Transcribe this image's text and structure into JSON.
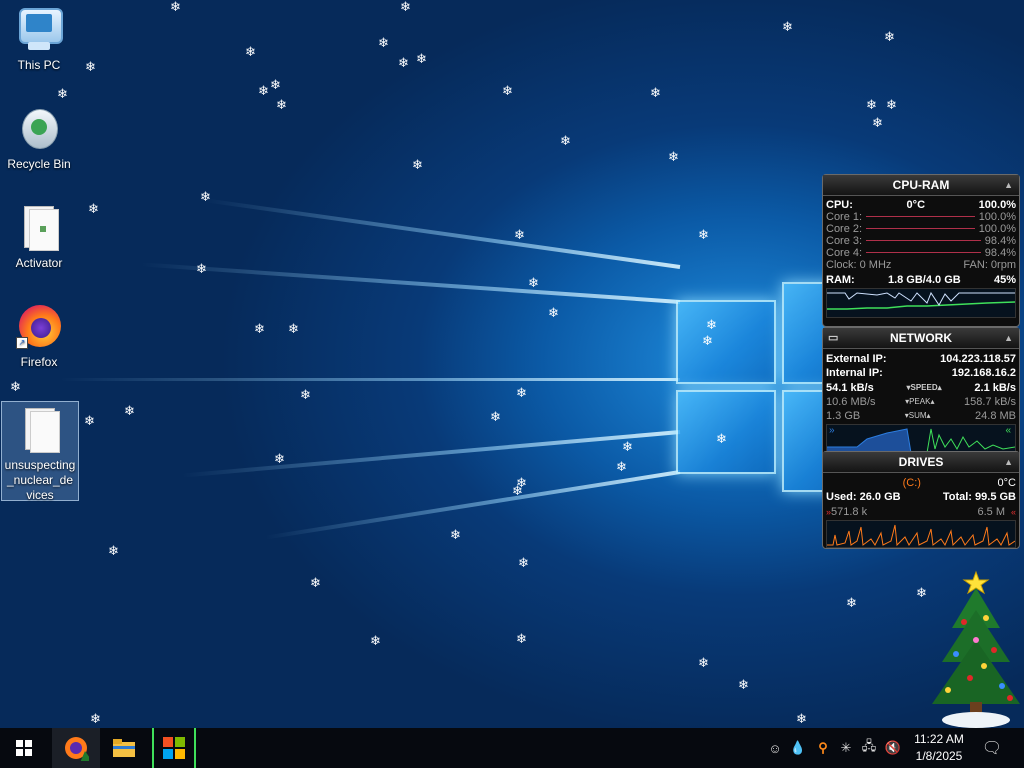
{
  "desktop": {
    "icons": [
      {
        "label": "This PC"
      },
      {
        "label": "Recycle Bin"
      },
      {
        "label": "Activator"
      },
      {
        "label": "Firefox"
      },
      {
        "label": "unsuspecting_nuclear_devices"
      }
    ]
  },
  "cpu_ram": {
    "title": "CPU-RAM",
    "cpu_label": "CPU:",
    "cpu_temp": "0°C",
    "cpu_value": "100.0%",
    "cores": [
      {
        "label": "Core 1:",
        "value": "100.0%"
      },
      {
        "label": "Core 2:",
        "value": "100.0%"
      },
      {
        "label": "Core 3:",
        "value": "98.4%"
      },
      {
        "label": "Core 4:",
        "value": "98.4%"
      }
    ],
    "clock": "Clock: 0 MHz",
    "fan": "FAN: 0rpm",
    "ram_label": "RAM:",
    "ram_value": "1.8 GB/4.0 GB",
    "ram_pct": "45%"
  },
  "network": {
    "title": "NETWORK",
    "external_label": "External IP:",
    "external_value": "104.223.118.57",
    "internal_label": "Internal IP:",
    "internal_value": "192.168.16.2",
    "rows": [
      {
        "left": "54.1 kB/s",
        "mid": "SPEED",
        "right": "2.1 kB/s"
      },
      {
        "left": "10.6 MB/s",
        "mid": "PEAK",
        "right": "158.7 kB/s"
      },
      {
        "left": "1.3 GB",
        "mid": "SUM",
        "right": "24.8 MB"
      }
    ]
  },
  "drives": {
    "title": "DRIVES",
    "drive": "(C:)",
    "temp": "0°C",
    "used": "Used: 26.0 GB",
    "total": "Total: 99.5 GB",
    "read": "571.8 k",
    "write": "6.5 M"
  },
  "taskbar": {
    "time": "11:22 AM",
    "date": "1/8/2025"
  },
  "colors": {
    "accent_green": "#3fe05a",
    "drive_orange": "#ff7a1a",
    "network_blue": "#2c7de0",
    "selection": "#7aa0d2"
  }
}
